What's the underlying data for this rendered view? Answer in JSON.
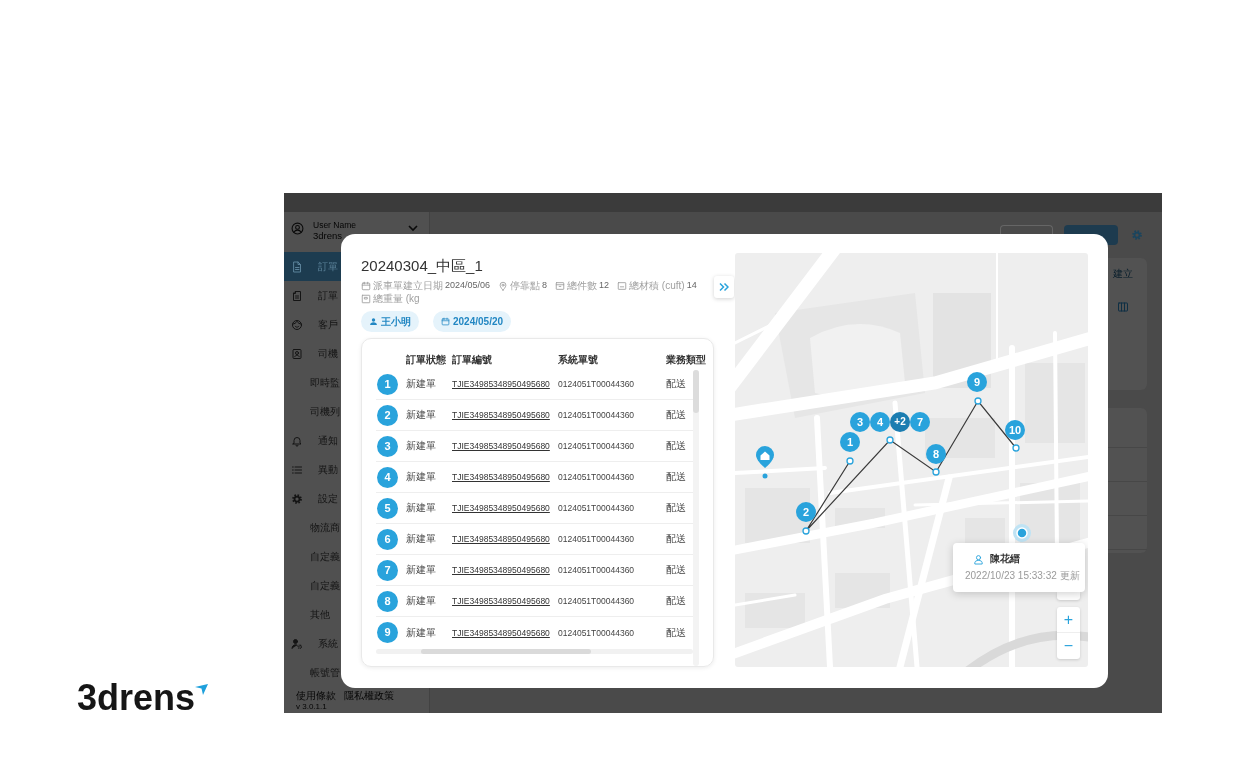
{
  "logo": {
    "text": "3drens"
  },
  "app": {
    "sidebar": {
      "user": {
        "name": "User Name",
        "org": "3drens"
      },
      "items": [
        {
          "label": "訂單",
          "kind": "main",
          "selected": true
        },
        {
          "label": "訂單",
          "kind": "main",
          "selected": false
        },
        {
          "label": "客戶",
          "kind": "main",
          "selected": false
        },
        {
          "label": "司機",
          "kind": "main",
          "selected": false
        },
        {
          "label": "即時監",
          "kind": "sub",
          "selected": false
        },
        {
          "label": "司機列",
          "kind": "sub",
          "selected": false
        },
        {
          "label": "通知",
          "kind": "main",
          "selected": false
        },
        {
          "label": "異動",
          "kind": "main",
          "selected": false
        },
        {
          "label": "設定",
          "kind": "main",
          "selected": false
        },
        {
          "label": "物流商",
          "kind": "sub",
          "selected": false
        },
        {
          "label": "自定義",
          "kind": "sub",
          "selected": false
        },
        {
          "label": "自定義",
          "kind": "sub",
          "selected": false
        },
        {
          "label": "其他",
          "kind": "sub",
          "selected": false
        },
        {
          "label": "系統",
          "kind": "main",
          "selected": false
        },
        {
          "label": "帳號管",
          "kind": "sub",
          "selected": false
        }
      ],
      "footer_links": [
        "使用條款",
        "隱私權政策"
      ],
      "version": "v 3.0.1.1"
    },
    "toolbar": {
      "tab": "建立"
    }
  },
  "dialog": {
    "title": "20240304_中區_1",
    "meta": [
      {
        "label": "派車單建立日期",
        "value": "2024/05/06"
      },
      {
        "label": "停靠點",
        "value": "8"
      },
      {
        "label": "總件數",
        "value": "12"
      },
      {
        "label": "總材積 (cuft)",
        "value": "14"
      },
      {
        "label": "總重量 (kg"
      }
    ],
    "chips": [
      {
        "kind": "driver",
        "text": "王小明"
      },
      {
        "kind": "date",
        "text": "2024/05/20"
      }
    ],
    "table": {
      "columns": [
        "訂單狀態",
        "訂單編號",
        "系統單號",
        "業務類型"
      ],
      "rows": [
        {
          "seq": "1",
          "status": "新建單",
          "order_no": "TJIE34985348950495680",
          "system_no": "0124051T00044360",
          "type": "配送"
        },
        {
          "seq": "2",
          "status": "新建單",
          "order_no": "TJIE34985348950495680",
          "system_no": "0124051T00044360",
          "type": "配送"
        },
        {
          "seq": "3",
          "status": "新建單",
          "order_no": "TJIE34985348950495680",
          "system_no": "0124051T00044360",
          "type": "配送"
        },
        {
          "seq": "4",
          "status": "新建單",
          "order_no": "TJIE34985348950495680",
          "system_no": "0124051T00044360",
          "type": "配送"
        },
        {
          "seq": "5",
          "status": "新建單",
          "order_no": "TJIE34985348950495680",
          "system_no": "0124051T00044360",
          "type": "配送"
        },
        {
          "seq": "6",
          "status": "新建單",
          "order_no": "TJIE34985348950495680",
          "system_no": "0124051T00044360",
          "type": "配送"
        },
        {
          "seq": "7",
          "status": "新建單",
          "order_no": "TJIE34985348950495680",
          "system_no": "0124051T00044360",
          "type": "配送"
        },
        {
          "seq": "8",
          "status": "新建單",
          "order_no": "TJIE34985348950495680",
          "system_no": "0124051T00044360",
          "type": "配送"
        },
        {
          "seq": "9",
          "status": "新建單",
          "order_no": "TJIE34985348950495680",
          "system_no": "0124051T00044360",
          "type": "配送"
        }
      ]
    },
    "map": {
      "markers": [
        {
          "kind": "stop",
          "label": "1"
        },
        {
          "kind": "stop",
          "label": "2"
        },
        {
          "kind": "stop",
          "label": "3"
        },
        {
          "kind": "stop",
          "label": "4"
        },
        {
          "kind": "cluster",
          "label": "+2"
        },
        {
          "kind": "stop",
          "label": "7"
        },
        {
          "kind": "stop",
          "label": "8"
        },
        {
          "kind": "stop",
          "label": "9"
        },
        {
          "kind": "stop",
          "label": "10"
        }
      ],
      "driver_card": {
        "name": "陳花縉",
        "updated": "2022/10/23 15:33:32 更新"
      },
      "zoom_in": "+",
      "zoom_out": "−"
    }
  }
}
